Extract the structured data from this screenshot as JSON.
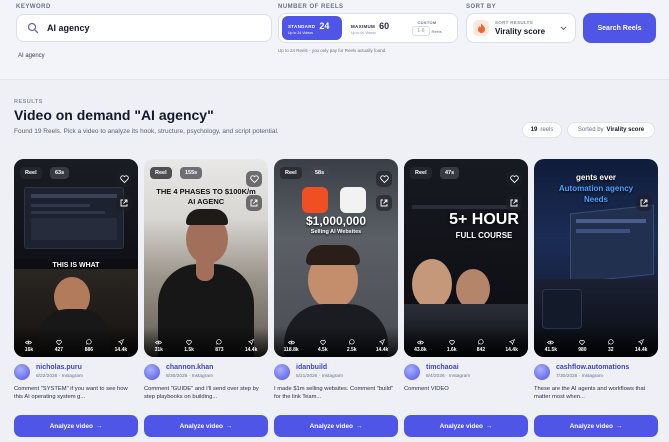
{
  "search": {
    "keyword_label": "KEYWORD",
    "keyword_value": "AI agency",
    "recent_chip": "AI agency",
    "reels_label": "NUMBER OF REELS",
    "options": [
      {
        "name": "STANDARD",
        "count": "24",
        "sub": "Up to 24 Videos"
      },
      {
        "name": "MAXIMUM",
        "count": "60",
        "sub": "Up to 60 Videos"
      },
      {
        "name": "CUSTOM",
        "count": "1-6",
        "sub": "Reels"
      }
    ],
    "reels_note": "Up to 24 Reels - you only pay for Reels actually found.",
    "sort_label": "SORT BY",
    "sort_small": "SORT RESULTS",
    "sort_value": "Virality score",
    "button": "Search Reels"
  },
  "results": {
    "label": "RESULTS",
    "title": "Video on demand \"AI agency\"",
    "subtitle": "Found 19 Reels. Pick a video to analyze its hook, structure, psychology, and script potential.",
    "count": "19",
    "count_unit": "reels",
    "sorted_prefix": "Sorted by",
    "sorted_value": "Virality score"
  },
  "cards": [
    {
      "tag": "Reel",
      "duration": "63s",
      "caption": "THIS IS WHAT",
      "views": "16k",
      "likes": "427",
      "comments": "886",
      "shares": "14.4k",
      "username": "nicholas.puru",
      "date": "8/22/2026",
      "platform": "Instagram",
      "desc": "Comment \"SYSTEM\" if you want to see how this AI operating system g...",
      "cta": "Analyze video"
    },
    {
      "tag": "Reel",
      "duration": "155s",
      "caption": "THE 4 PHASES TO $100K/m AI AGENC",
      "views": "31k",
      "likes": "1.5k",
      "comments": "873",
      "shares": "14.4k",
      "username": "channon.khan",
      "date": "8/30/2026",
      "platform": "Instagram",
      "desc": "Comment \"GUIDE\" and I'll send over step by step playbooks on building...",
      "cta": "Analyze video"
    },
    {
      "tag": "Reel",
      "duration": "58s",
      "caption": "$1,000,000",
      "caption2": "Selling AI Websites",
      "views": "118.8k",
      "likes": "4.5k",
      "comments": "2.5k",
      "shares": "14.4k",
      "username": "idanbuild",
      "date": "5/21/2026",
      "platform": "Instagram",
      "desc": "I made $1m selling websites. Comment \"build\" for the link Team...",
      "cta": "Analyze video"
    },
    {
      "tag": "Reel",
      "duration": "47s",
      "caption": "5+ HOUR",
      "caption2": "FULL COURSE",
      "views": "43.8k",
      "likes": "1.6k",
      "comments": "842",
      "shares": "14.4k",
      "username": "timchaoai",
      "date": "8/4/2026",
      "platform": "Instagram",
      "desc": "Comment VIDEO",
      "cta": "Analyze video"
    },
    {
      "tag": "",
      "duration": "",
      "caption": "gents ever",
      "caption2": "Automation agency",
      "caption3": "Needs",
      "views": "41.5k",
      "likes": "980",
      "comments": "32",
      "shares": "14.4k",
      "username": "cashflow.automations",
      "date": "7/30/2026",
      "platform": "Instagram",
      "desc": "These are the AI agents and workflows that matter most when...",
      "cta": "Analyze video"
    }
  ],
  "colors": {
    "accent": "#4f55e6",
    "username": "#3d43d8"
  },
  "icons": [
    "search-icon",
    "flame-icon",
    "chevron-down-icon",
    "heart-icon",
    "external-link-icon",
    "eye-icon",
    "comment-icon",
    "share-icon",
    "arrow-right-icon"
  ]
}
